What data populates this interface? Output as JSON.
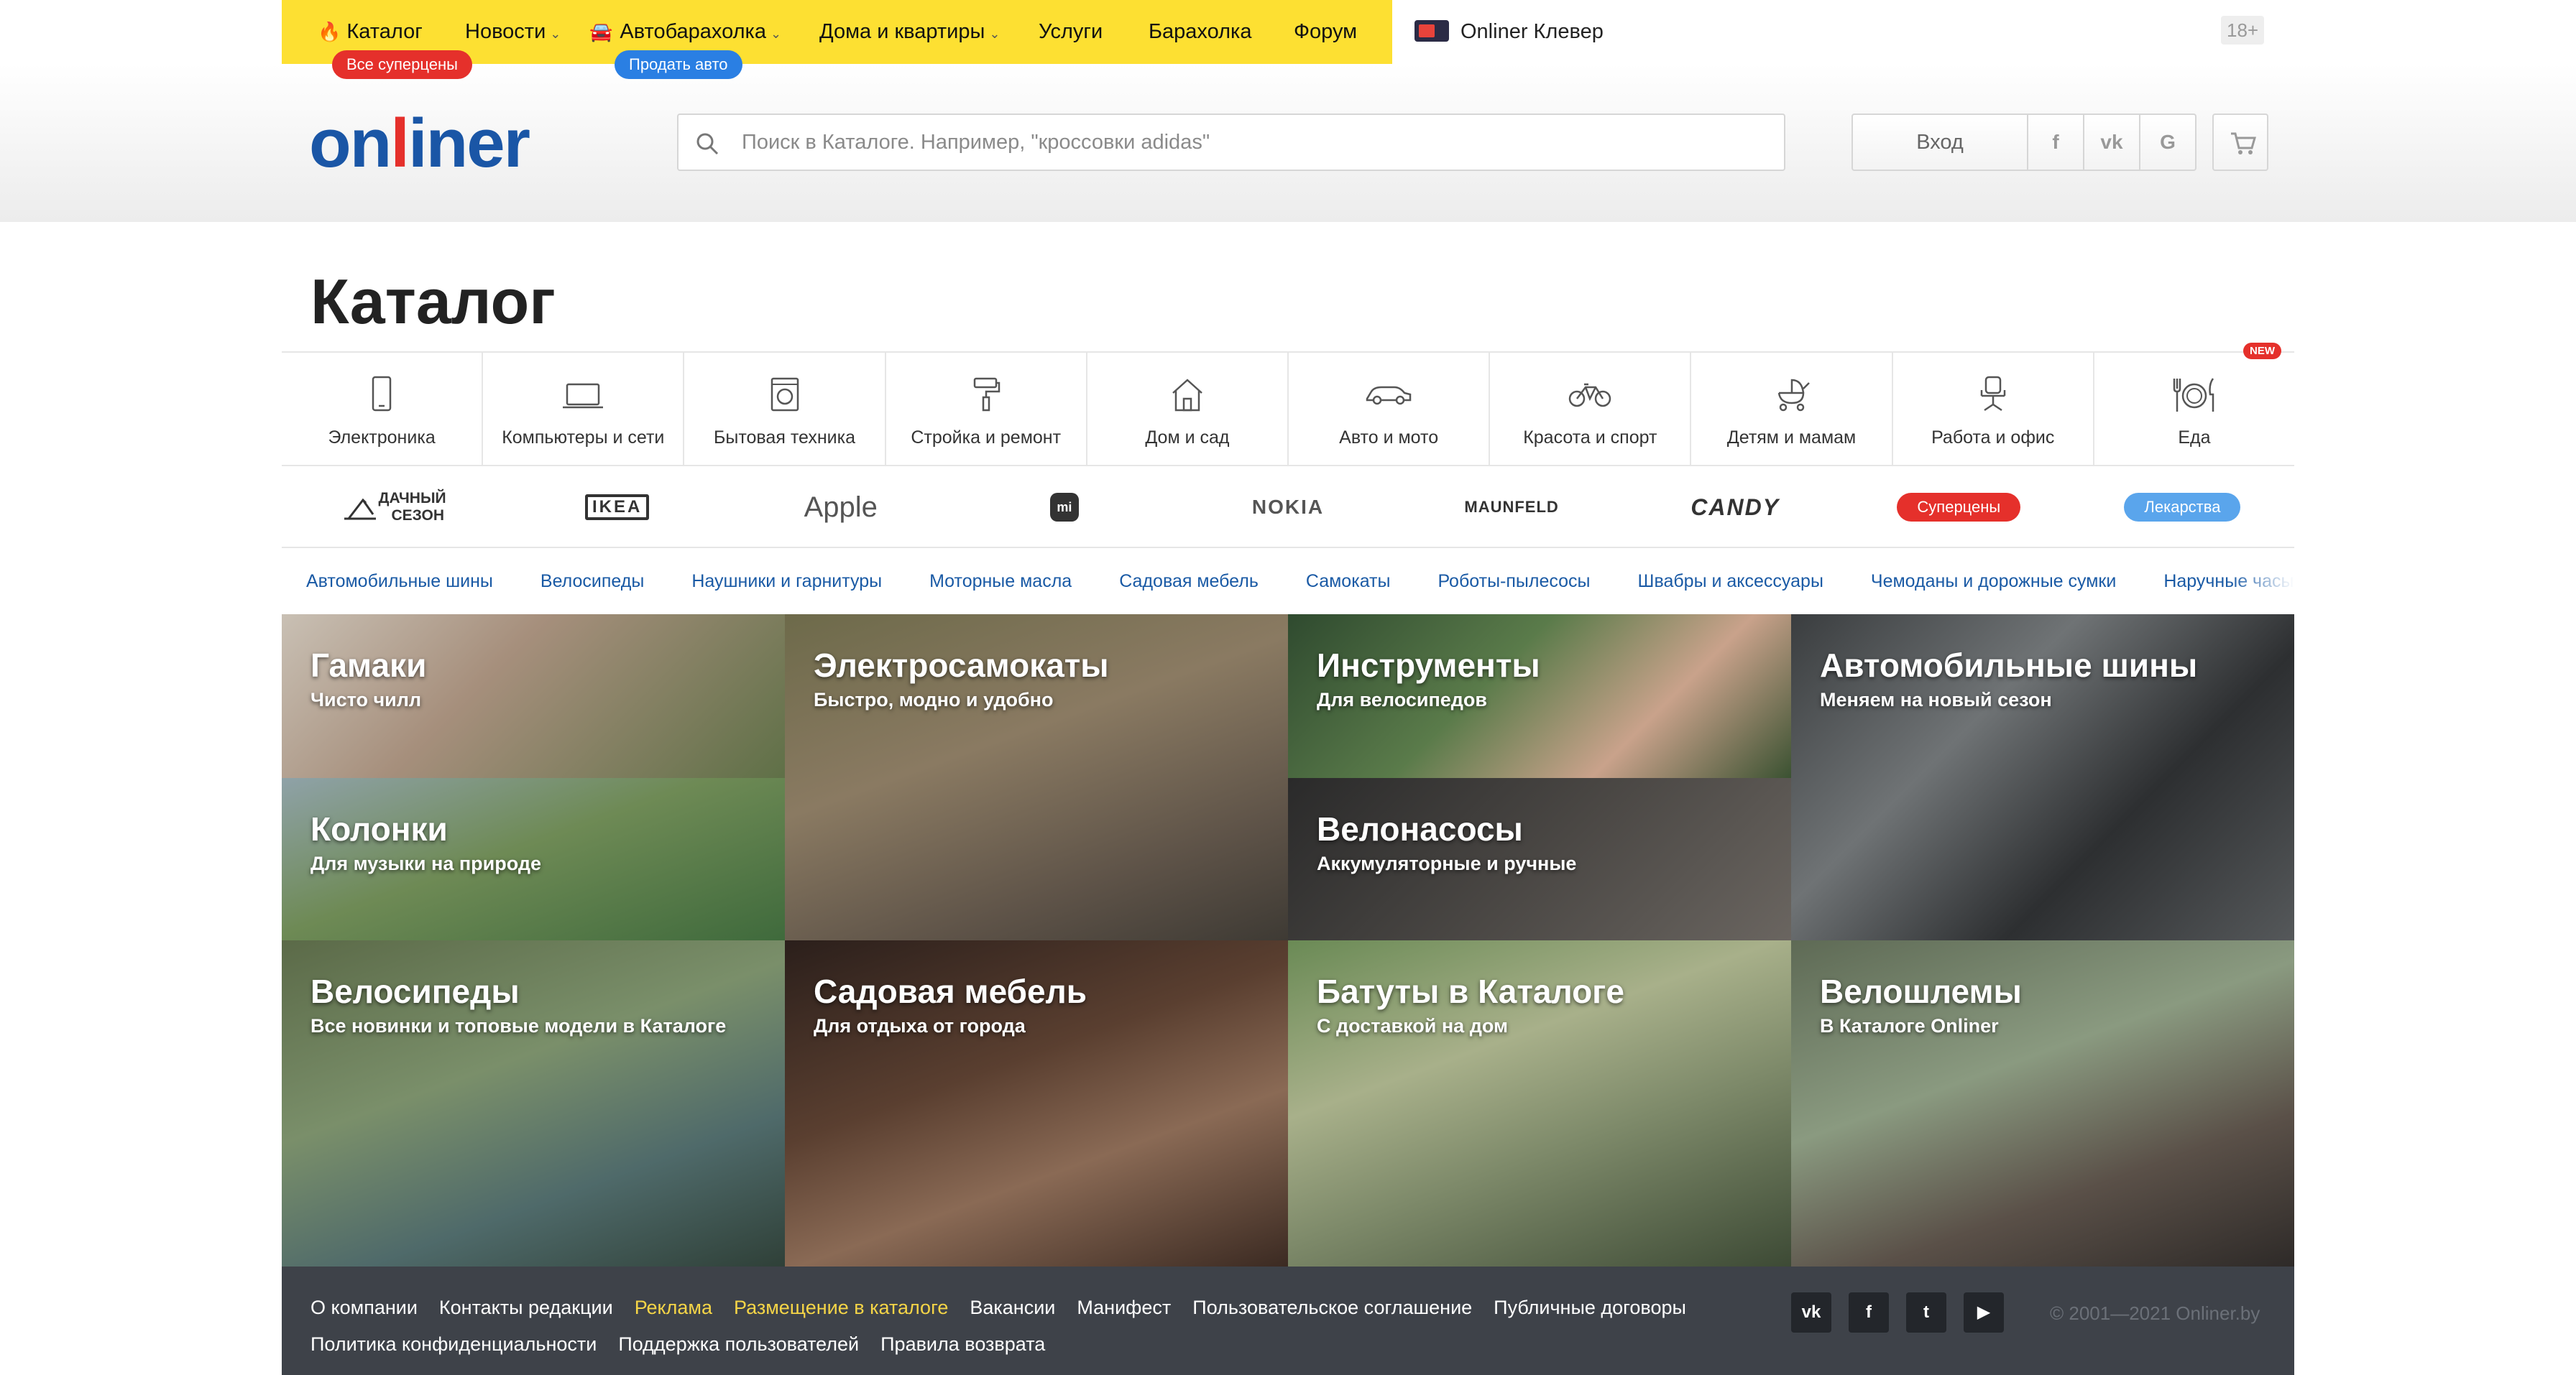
{
  "topnav": {
    "items": [
      {
        "label": "Каталог"
      },
      {
        "label": "Новости"
      },
      {
        "label": "Автобарахолка"
      },
      {
        "label": "Дома и квартиры"
      },
      {
        "label": "Услуги"
      },
      {
        "label": "Барахолка"
      },
      {
        "label": "Форум"
      }
    ],
    "badge_catalog": "Все суперцены",
    "badge_auto": "Продать авто",
    "clever": "Onliner Клевер",
    "age": "18+"
  },
  "header": {
    "logo": {
      "a": "on",
      "b": "l",
      "c": "iner"
    },
    "search_placeholder": "Поиск в Каталоге. Например, \"кроссовки adidas\"",
    "login": "Вход",
    "social": [
      "f",
      "vk",
      "G"
    ]
  },
  "catalog": {
    "title": "Каталог",
    "categories": [
      {
        "label": "Электроника",
        "icon": "phone-icon"
      },
      {
        "label": "Компьютеры и сети",
        "icon": "laptop-icon"
      },
      {
        "label": "Бытовая техника",
        "icon": "washing-machine-icon"
      },
      {
        "label": "Стройка и ремонт",
        "icon": "paint-roller-icon"
      },
      {
        "label": "Дом и сад",
        "icon": "house-icon"
      },
      {
        "label": "Авто и мото",
        "icon": "car-icon"
      },
      {
        "label": "Красота и спорт",
        "icon": "bicycle-icon"
      },
      {
        "label": "Детям и мамам",
        "icon": "stroller-icon"
      },
      {
        "label": "Работа и офис",
        "icon": "office-chair-icon"
      },
      {
        "label": "Еда",
        "icon": "plate-icon"
      }
    ],
    "new_badge": "NEW",
    "brands": {
      "dacha_1": "ДАЧНЫЙ",
      "dacha_2": "СЕЗОН",
      "ikea": "IKEA",
      "apple": "Apple",
      "mi": "mi",
      "nokia": "NOKIA",
      "maunfeld": "MAUNFELD",
      "candy": "CANDY",
      "supercena": "Суперцены",
      "lekarstva": "Лекарства"
    },
    "quick_links": [
      "Автомобильные шины",
      "Велосипеды",
      "Наушники и гарнитуры",
      "Моторные масла",
      "Садовая мебель",
      "Самокаты",
      "Роботы-пылесосы",
      "Швабры и аксессуары",
      "Чемоданы и дорожные сумки",
      "Наручные часы"
    ]
  },
  "tiles": {
    "gamaki": {
      "title": "Гамаки",
      "sub": "Чисто чилл"
    },
    "kolonki": {
      "title": "Колонки",
      "sub": "Для музыки на природе"
    },
    "samokaty": {
      "title": "Электросамокаты",
      "sub": "Быстро, модно и удобно"
    },
    "instrumenty": {
      "title": "Инструменты",
      "sub": "Для велосипедов"
    },
    "velonasosy": {
      "title": "Велонасосы",
      "sub": "Аккумуляторные и ручные"
    },
    "shiny": {
      "title": "Автомобильные шины",
      "sub": "Меняем на новый сезон"
    },
    "velosipedy": {
      "title": "Велосипеды",
      "sub": "Все новинки и топовые модели в Каталоге"
    },
    "mebel": {
      "title": "Садовая мебель",
      "sub": "Для отдыха от города"
    },
    "batuty": {
      "title": "Батуты в Каталоге",
      "sub": "С доставкой на дом"
    },
    "veloshlemy": {
      "title": "Велошлемы",
      "sub": "В Каталоге Onliner"
    }
  },
  "footer": {
    "links": [
      "О компании",
      "Контакты редакции",
      "Реклама",
      "Размещение в каталоге",
      "Вакансии",
      "Манифест",
      "Пользовательское соглашение",
      "Публичные договоры",
      "Политика конфиденциальности",
      "Поддержка пользователей",
      "Правила возврата"
    ],
    "social": [
      "vk",
      "f",
      "t",
      "▶"
    ],
    "copyright": "© 2001—2021 Onliner.by"
  }
}
